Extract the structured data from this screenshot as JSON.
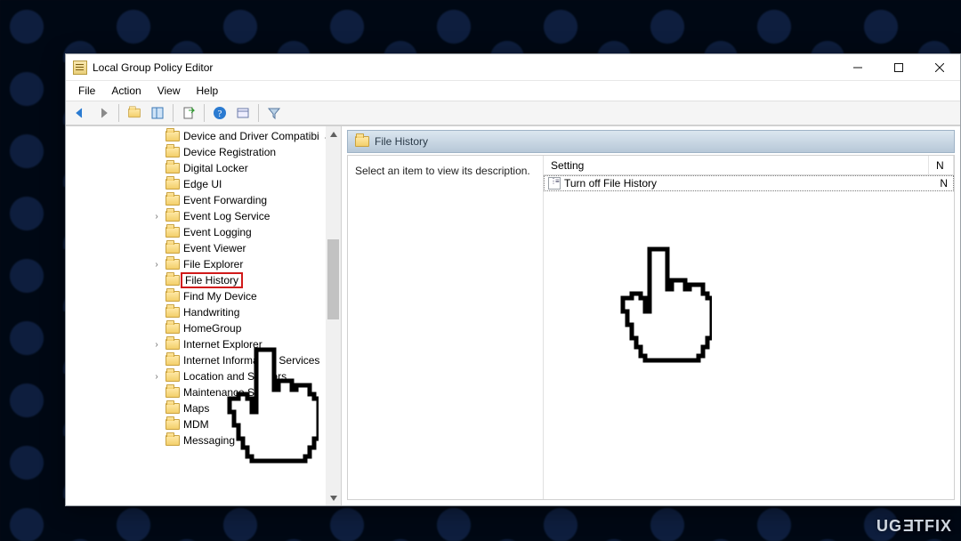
{
  "window": {
    "title": "Local Group Policy Editor"
  },
  "menus": {
    "file": "File",
    "action": "Action",
    "view": "View",
    "help": "Help"
  },
  "tree": {
    "items": [
      {
        "label": "Device and Driver Compatibi",
        "arrow": "up",
        "expandable": false
      },
      {
        "label": "Device Registration",
        "expandable": false
      },
      {
        "label": "Digital Locker",
        "expandable": false
      },
      {
        "label": "Edge UI",
        "expandable": false
      },
      {
        "label": "Event Forwarding",
        "expandable": false
      },
      {
        "label": "Event Log Service",
        "expandable": true
      },
      {
        "label": "Event Logging",
        "expandable": false
      },
      {
        "label": "Event Viewer",
        "expandable": false
      },
      {
        "label": "File Explorer",
        "expandable": true
      },
      {
        "label": "File History",
        "expandable": false,
        "highlight": true
      },
      {
        "label": "Find My Device",
        "expandable": false
      },
      {
        "label": "Handwriting",
        "expandable": false
      },
      {
        "label": "HomeGroup",
        "expandable": false
      },
      {
        "label": "Internet Explorer",
        "expandable": true
      },
      {
        "label": "Internet Information Services",
        "expandable": false
      },
      {
        "label": "Location and Sensors",
        "expandable": true
      },
      {
        "label": "Maintenance Scheduler",
        "expandable": false
      },
      {
        "label": "Maps",
        "expandable": false
      },
      {
        "label": "MDM",
        "expandable": false
      },
      {
        "label": "Messaging",
        "expandable": false
      }
    ]
  },
  "content": {
    "header": "File History",
    "description": "Select an item to view its description.",
    "columns": {
      "setting": "Setting",
      "state": "N"
    },
    "rows": [
      {
        "label": "Turn off File History",
        "state": "N"
      }
    ]
  },
  "watermark": "UG   TFIX"
}
